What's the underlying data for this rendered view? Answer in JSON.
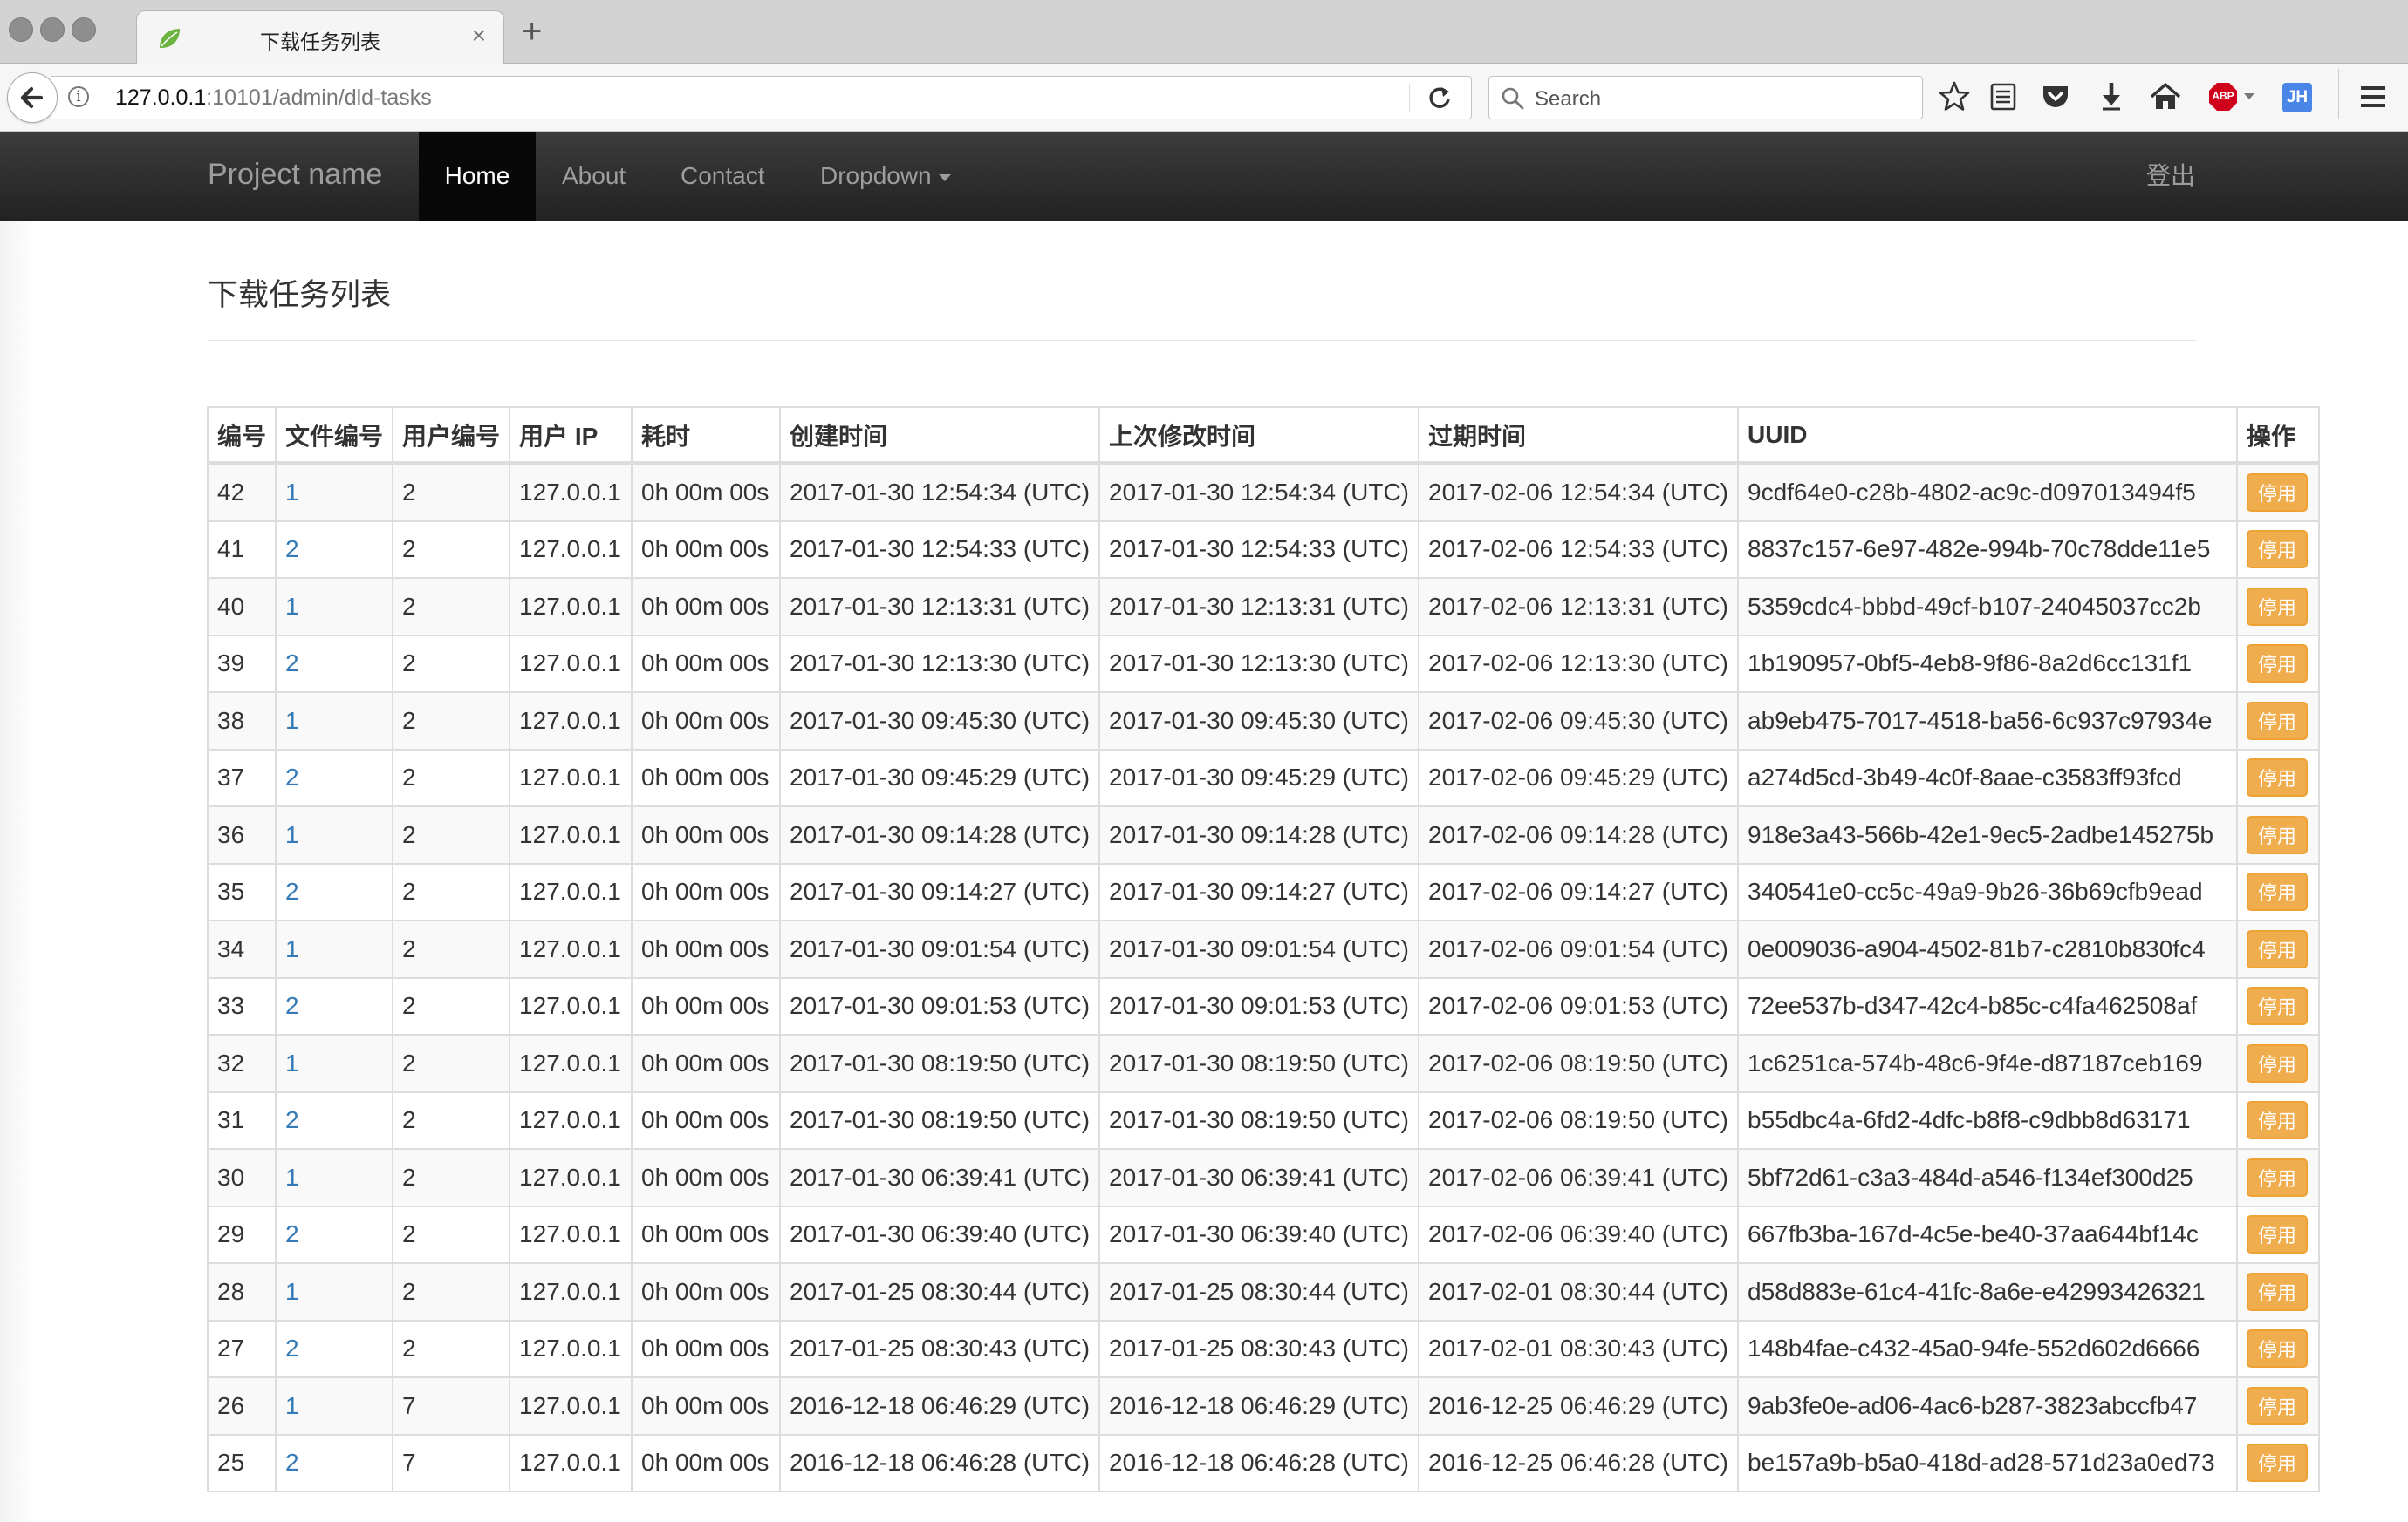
{
  "browser": {
    "tab_title": "下载任务列表",
    "url_host": "127.0.0.1",
    "url_rest": ":10101/admin/dld-tasks",
    "search_placeholder": "Search",
    "abp_label": "ABP",
    "profile_label": "JH"
  },
  "nav": {
    "brand": "Project name",
    "items": [
      "Home",
      "About",
      "Contact",
      "Dropdown"
    ],
    "active": "Home",
    "logout": "登出"
  },
  "page": {
    "title": "下载任务列表"
  },
  "table": {
    "headers": [
      "编号",
      "文件编号",
      "用户编号",
      "用户 IP",
      "耗时",
      "创建时间",
      "上次修改时间",
      "过期时间",
      "UUID",
      "操作"
    ],
    "action_label": "停用",
    "rows": [
      {
        "id": "42",
        "file": "1",
        "user": "2",
        "ip": "127.0.0.1",
        "dur": "0h 00m 00s",
        "created": "2017-01-30 12:54:34 (UTC)",
        "modified": "2017-01-30 12:54:34 (UTC)",
        "expires": "2017-02-06 12:54:34 (UTC)",
        "uuid": "9cdf64e0-c28b-4802-ac9c-d097013494f5"
      },
      {
        "id": "41",
        "file": "2",
        "user": "2",
        "ip": "127.0.0.1",
        "dur": "0h 00m 00s",
        "created": "2017-01-30 12:54:33 (UTC)",
        "modified": "2017-01-30 12:54:33 (UTC)",
        "expires": "2017-02-06 12:54:33 (UTC)",
        "uuid": "8837c157-6e97-482e-994b-70c78dde11e5"
      },
      {
        "id": "40",
        "file": "1",
        "user": "2",
        "ip": "127.0.0.1",
        "dur": "0h 00m 00s",
        "created": "2017-01-30 12:13:31 (UTC)",
        "modified": "2017-01-30 12:13:31 (UTC)",
        "expires": "2017-02-06 12:13:31 (UTC)",
        "uuid": "5359cdc4-bbbd-49cf-b107-24045037cc2b"
      },
      {
        "id": "39",
        "file": "2",
        "user": "2",
        "ip": "127.0.0.1",
        "dur": "0h 00m 00s",
        "created": "2017-01-30 12:13:30 (UTC)",
        "modified": "2017-01-30 12:13:30 (UTC)",
        "expires": "2017-02-06 12:13:30 (UTC)",
        "uuid": "1b190957-0bf5-4eb8-9f86-8a2d6cc131f1"
      },
      {
        "id": "38",
        "file": "1",
        "user": "2",
        "ip": "127.0.0.1",
        "dur": "0h 00m 00s",
        "created": "2017-01-30 09:45:30 (UTC)",
        "modified": "2017-01-30 09:45:30 (UTC)",
        "expires": "2017-02-06 09:45:30 (UTC)",
        "uuid": "ab9eb475-7017-4518-ba56-6c937c97934e"
      },
      {
        "id": "37",
        "file": "2",
        "user": "2",
        "ip": "127.0.0.1",
        "dur": "0h 00m 00s",
        "created": "2017-01-30 09:45:29 (UTC)",
        "modified": "2017-01-30 09:45:29 (UTC)",
        "expires": "2017-02-06 09:45:29 (UTC)",
        "uuid": "a274d5cd-3b49-4c0f-8aae-c3583ff93fcd"
      },
      {
        "id": "36",
        "file": "1",
        "user": "2",
        "ip": "127.0.0.1",
        "dur": "0h 00m 00s",
        "created": "2017-01-30 09:14:28 (UTC)",
        "modified": "2017-01-30 09:14:28 (UTC)",
        "expires": "2017-02-06 09:14:28 (UTC)",
        "uuid": "918e3a43-566b-42e1-9ec5-2adbe145275b"
      },
      {
        "id": "35",
        "file": "2",
        "user": "2",
        "ip": "127.0.0.1",
        "dur": "0h 00m 00s",
        "created": "2017-01-30 09:14:27 (UTC)",
        "modified": "2017-01-30 09:14:27 (UTC)",
        "expires": "2017-02-06 09:14:27 (UTC)",
        "uuid": "340541e0-cc5c-49a9-9b26-36b69cfb9ead"
      },
      {
        "id": "34",
        "file": "1",
        "user": "2",
        "ip": "127.0.0.1",
        "dur": "0h 00m 00s",
        "created": "2017-01-30 09:01:54 (UTC)",
        "modified": "2017-01-30 09:01:54 (UTC)",
        "expires": "2017-02-06 09:01:54 (UTC)",
        "uuid": "0e009036-a904-4502-81b7-c2810b830fc4"
      },
      {
        "id": "33",
        "file": "2",
        "user": "2",
        "ip": "127.0.0.1",
        "dur": "0h 00m 00s",
        "created": "2017-01-30 09:01:53 (UTC)",
        "modified": "2017-01-30 09:01:53 (UTC)",
        "expires": "2017-02-06 09:01:53 (UTC)",
        "uuid": "72ee537b-d347-42c4-b85c-c4fa462508af"
      },
      {
        "id": "32",
        "file": "1",
        "user": "2",
        "ip": "127.0.0.1",
        "dur": "0h 00m 00s",
        "created": "2017-01-30 08:19:50 (UTC)",
        "modified": "2017-01-30 08:19:50 (UTC)",
        "expires": "2017-02-06 08:19:50 (UTC)",
        "uuid": "1c6251ca-574b-48c6-9f4e-d87187ceb169"
      },
      {
        "id": "31",
        "file": "2",
        "user": "2",
        "ip": "127.0.0.1",
        "dur": "0h 00m 00s",
        "created": "2017-01-30 08:19:50 (UTC)",
        "modified": "2017-01-30 08:19:50 (UTC)",
        "expires": "2017-02-06 08:19:50 (UTC)",
        "uuid": "b55dbc4a-6fd2-4dfc-b8f8-c9dbb8d63171"
      },
      {
        "id": "30",
        "file": "1",
        "user": "2",
        "ip": "127.0.0.1",
        "dur": "0h 00m 00s",
        "created": "2017-01-30 06:39:41 (UTC)",
        "modified": "2017-01-30 06:39:41 (UTC)",
        "expires": "2017-02-06 06:39:41 (UTC)",
        "uuid": "5bf72d61-c3a3-484d-a546-f134ef300d25"
      },
      {
        "id": "29",
        "file": "2",
        "user": "2",
        "ip": "127.0.0.1",
        "dur": "0h 00m 00s",
        "created": "2017-01-30 06:39:40 (UTC)",
        "modified": "2017-01-30 06:39:40 (UTC)",
        "expires": "2017-02-06 06:39:40 (UTC)",
        "uuid": "667fb3ba-167d-4c5e-be40-37aa644bf14c"
      },
      {
        "id": "28",
        "file": "1",
        "user": "2",
        "ip": "127.0.0.1",
        "dur": "0h 00m 00s",
        "created": "2017-01-25 08:30:44 (UTC)",
        "modified": "2017-01-25 08:30:44 (UTC)",
        "expires": "2017-02-01 08:30:44 (UTC)",
        "uuid": "d58d883e-61c4-41fc-8a6e-e42993426321"
      },
      {
        "id": "27",
        "file": "2",
        "user": "2",
        "ip": "127.0.0.1",
        "dur": "0h 00m 00s",
        "created": "2017-01-25 08:30:43 (UTC)",
        "modified": "2017-01-25 08:30:43 (UTC)",
        "expires": "2017-02-01 08:30:43 (UTC)",
        "uuid": "148b4fae-c432-45a0-94fe-552d602d6666"
      },
      {
        "id": "26",
        "file": "1",
        "user": "7",
        "ip": "127.0.0.1",
        "dur": "0h 00m 00s",
        "created": "2016-12-18 06:46:29 (UTC)",
        "modified": "2016-12-18 06:46:29 (UTC)",
        "expires": "2016-12-25 06:46:29 (UTC)",
        "uuid": "9ab3fe0e-ad06-4ac6-b287-3823abccfb47"
      },
      {
        "id": "25",
        "file": "2",
        "user": "7",
        "ip": "127.0.0.1",
        "dur": "0h 00m 00s",
        "created": "2016-12-18 06:46:28 (UTC)",
        "modified": "2016-12-18 06:46:28 (UTC)",
        "expires": "2016-12-25 06:46:28 (UTC)",
        "uuid": "be157a9b-b5a0-418d-ad28-571d23a0ed73"
      }
    ]
  },
  "colors": {
    "navbar_bg": "#222222",
    "link": "#337ab7",
    "warning_button": "#f0ad4e"
  }
}
